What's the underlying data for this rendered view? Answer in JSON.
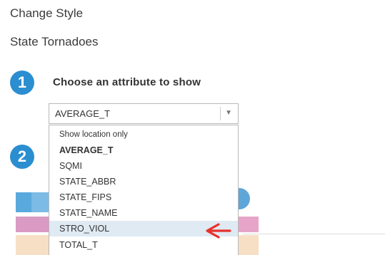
{
  "panel": {
    "title": "Change Style",
    "layer_name": "State Tornadoes"
  },
  "steps": [
    {
      "number": "1",
      "label": "Choose an attribute to show"
    },
    {
      "number": "2"
    }
  ],
  "attribute_select": {
    "selected": "AVERAGE_T",
    "options": [
      "Show location only",
      "AVERAGE_T",
      "SQMI",
      "STATE_ABBR",
      "STATE_FIPS",
      "STATE_NAME",
      "STRO_VIOL",
      "TOTAL_T"
    ],
    "highlighted_option": "STRO_VIOL"
  },
  "colors": {
    "accent": "#2b8ed0",
    "highlight": "#dfeaf3",
    "annotation": "#e8322c"
  },
  "icons": {
    "dropdown_arrow": "chevron-down-icon",
    "annotation": "red-arrow-pointer-icon"
  }
}
